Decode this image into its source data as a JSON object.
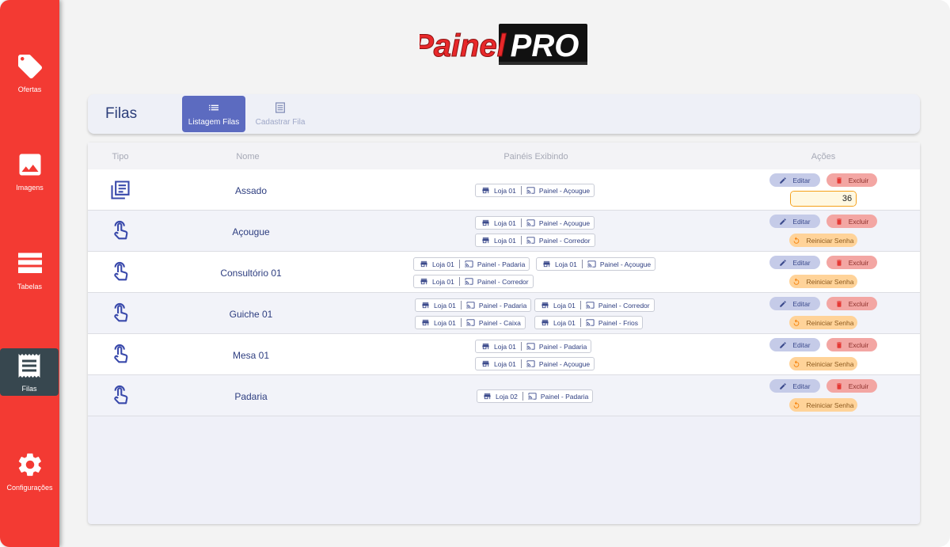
{
  "sidebar": {
    "items": [
      {
        "label": "Ofertas",
        "icon": "tag-icon"
      },
      {
        "label": "Imagens",
        "icon": "image-icon"
      },
      {
        "label": "Tabelas",
        "icon": "table-icon"
      },
      {
        "label": "Filas",
        "icon": "receipt-icon"
      },
      {
        "label": "Configurações",
        "icon": "gear-icon"
      }
    ],
    "active": "Filas"
  },
  "logo": {
    "part1": "Painel",
    "part2": "PRO"
  },
  "header": {
    "title": "Filas",
    "tabs": [
      {
        "label": "Listagem Filas",
        "icon": "list-icon"
      },
      {
        "label": "Cadastrar Fila",
        "icon": "form-icon"
      }
    ]
  },
  "table": {
    "columns": [
      "Tipo",
      "Nome",
      "Painéis Exibindo",
      "Ações"
    ],
    "rows": [
      {
        "type": "list-icon",
        "name": "Assado",
        "panels": [
          [
            "Loja 01",
            "Painel - Açougue"
          ]
        ],
        "numeric_value": "36"
      },
      {
        "type": "touch-icon",
        "name": "Açougue",
        "panels": [
          [
            "Loja 01",
            "Painel - Açougue"
          ],
          [
            "Loja 01",
            "Painel - Corredor"
          ]
        ]
      },
      {
        "type": "touch-icon",
        "name": "Consultório 01",
        "panels": [
          [
            "Loja 01",
            "Painel - Padaria"
          ],
          [
            "Loja 01",
            "Painel - Açougue"
          ],
          [
            "Loja 01",
            "Painel - Corredor"
          ]
        ]
      },
      {
        "type": "touch-icon",
        "name": "Guiche 01",
        "panels": [
          [
            "Loja 01",
            "Painel - Padaria"
          ],
          [
            "Loja 01",
            "Painel - Corredor"
          ],
          [
            "Loja 01",
            "Painel - Caixa"
          ],
          [
            "Loja 01",
            "Painel - Frios"
          ]
        ]
      },
      {
        "type": "touch-icon",
        "name": "Mesa 01",
        "panels": [
          [
            "Loja 01",
            "Painel - Padaria"
          ],
          [
            "Loja 01",
            "Painel - Açougue"
          ]
        ]
      },
      {
        "type": "touch-icon",
        "name": "Padaria",
        "panels": [
          [
            "Loja 02",
            "Painel - Padaria"
          ]
        ]
      }
    ]
  },
  "actions": {
    "edit": "Editar",
    "delete": "Excluir",
    "reset": "Reiniciar Senha"
  },
  "colors": {
    "sidebar": "#f33a33",
    "active_tab": "#5c6bc0",
    "accent_text": "#2e3e80",
    "confirm": "#f59c1a"
  }
}
